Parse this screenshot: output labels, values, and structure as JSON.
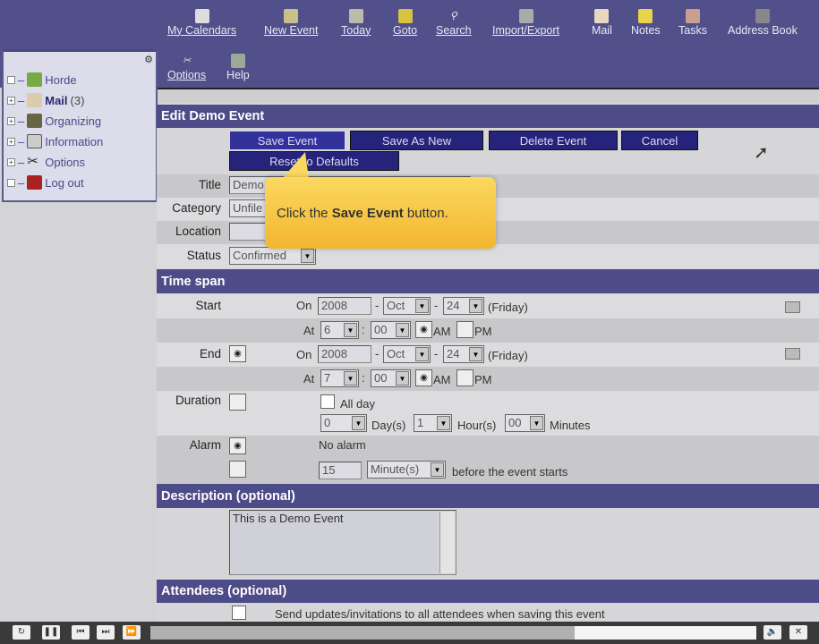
{
  "toolbar": {
    "items": [
      "My Calendars",
      "New Event",
      "Today",
      "Goto",
      "Search",
      "Import/Export",
      "Mail",
      "Notes",
      "Tasks",
      "Address Book"
    ],
    "row2": [
      "Options",
      "Help"
    ]
  },
  "sidebar": {
    "items": [
      {
        "label": "Horde"
      },
      {
        "label": "Mail",
        "count": "(3)"
      },
      {
        "label": "Organizing"
      },
      {
        "label": "Information"
      },
      {
        "label": "Options"
      },
      {
        "label": "Log out"
      }
    ]
  },
  "page_title": "Edit Demo Event",
  "buttons": {
    "save": "Save Event",
    "save_new": "Save As New",
    "delete": "Delete Event",
    "cancel": "Cancel",
    "reset": "Reset to Defaults"
  },
  "fields": {
    "title_label": "Title",
    "title_value": "Demo",
    "category_label": "Category",
    "category_value": "Unfile",
    "location_label": "Location",
    "location_value": "",
    "status_label": "Status",
    "status_value": "Confirmed"
  },
  "callout": {
    "pre": "Click the ",
    "bold": "Save Event",
    "post": " button."
  },
  "time_span": {
    "header": "Time span",
    "start_label": "Start",
    "end_label": "End",
    "on": "On",
    "at": "At",
    "start": {
      "year": "2008",
      "month": "Oct",
      "day": "24",
      "weekday": "(Friday)",
      "hour": "6",
      "minute": "00"
    },
    "end": {
      "year": "2008",
      "month": "Oct",
      "day": "24",
      "weekday": "(Friday)",
      "hour": "7",
      "minute": "00"
    },
    "am": "AM",
    "pm": "PM",
    "dash": "-",
    "colon": ":",
    "duration_label": "Duration",
    "all_day": "All day",
    "days": "0",
    "days_unit": "Day(s)",
    "hours": "1",
    "hours_unit": "Hour(s)",
    "minutes": "00",
    "minutes_unit": "Minutes",
    "alarm_label": "Alarm",
    "no_alarm": "No alarm",
    "alarm_value": "15",
    "alarm_unit": "Minute(s)",
    "alarm_suffix": "before the event starts"
  },
  "description": {
    "header": "Description (optional)",
    "value": "This is a Demo Event"
  },
  "attendees": {
    "header": "Attendees (optional)",
    "checkbox_label": "Send updates/invitations to all attendees when saving this event"
  },
  "player": {
    "progress": 0.7
  }
}
